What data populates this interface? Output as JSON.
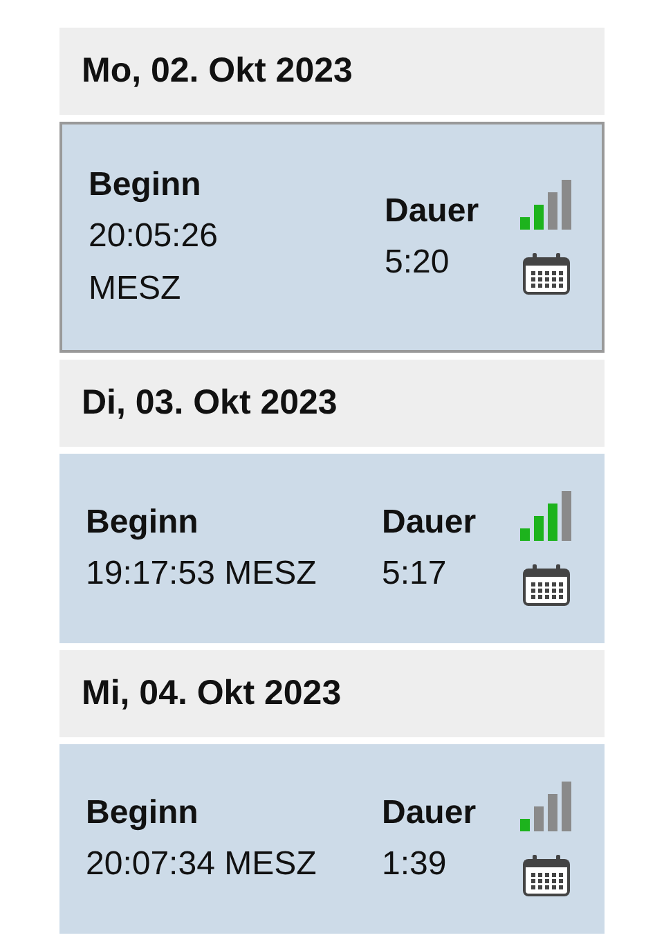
{
  "days": [
    {
      "date": "Mo, 02. Okt 2023",
      "entry": {
        "selected": true,
        "begin_label": "Beginn",
        "begin": "20:05:26 MESZ",
        "duration_label": "Dauer",
        "duration": "5:20",
        "level": 0.5
      }
    },
    {
      "date": "Di, 03. Okt 2023",
      "entry": {
        "selected": false,
        "begin_label": "Beginn",
        "begin": "19:17:53 MESZ",
        "duration_label": "Dauer",
        "duration": "5:17",
        "level": 0.75
      }
    },
    {
      "date": "Mi, 04. Okt 2023",
      "entry": {
        "selected": false,
        "begin_label": "Beginn",
        "begin": "20:07:34 MESZ",
        "duration_label": "Dauer",
        "duration": "1:39",
        "level": 0.25
      }
    }
  ]
}
